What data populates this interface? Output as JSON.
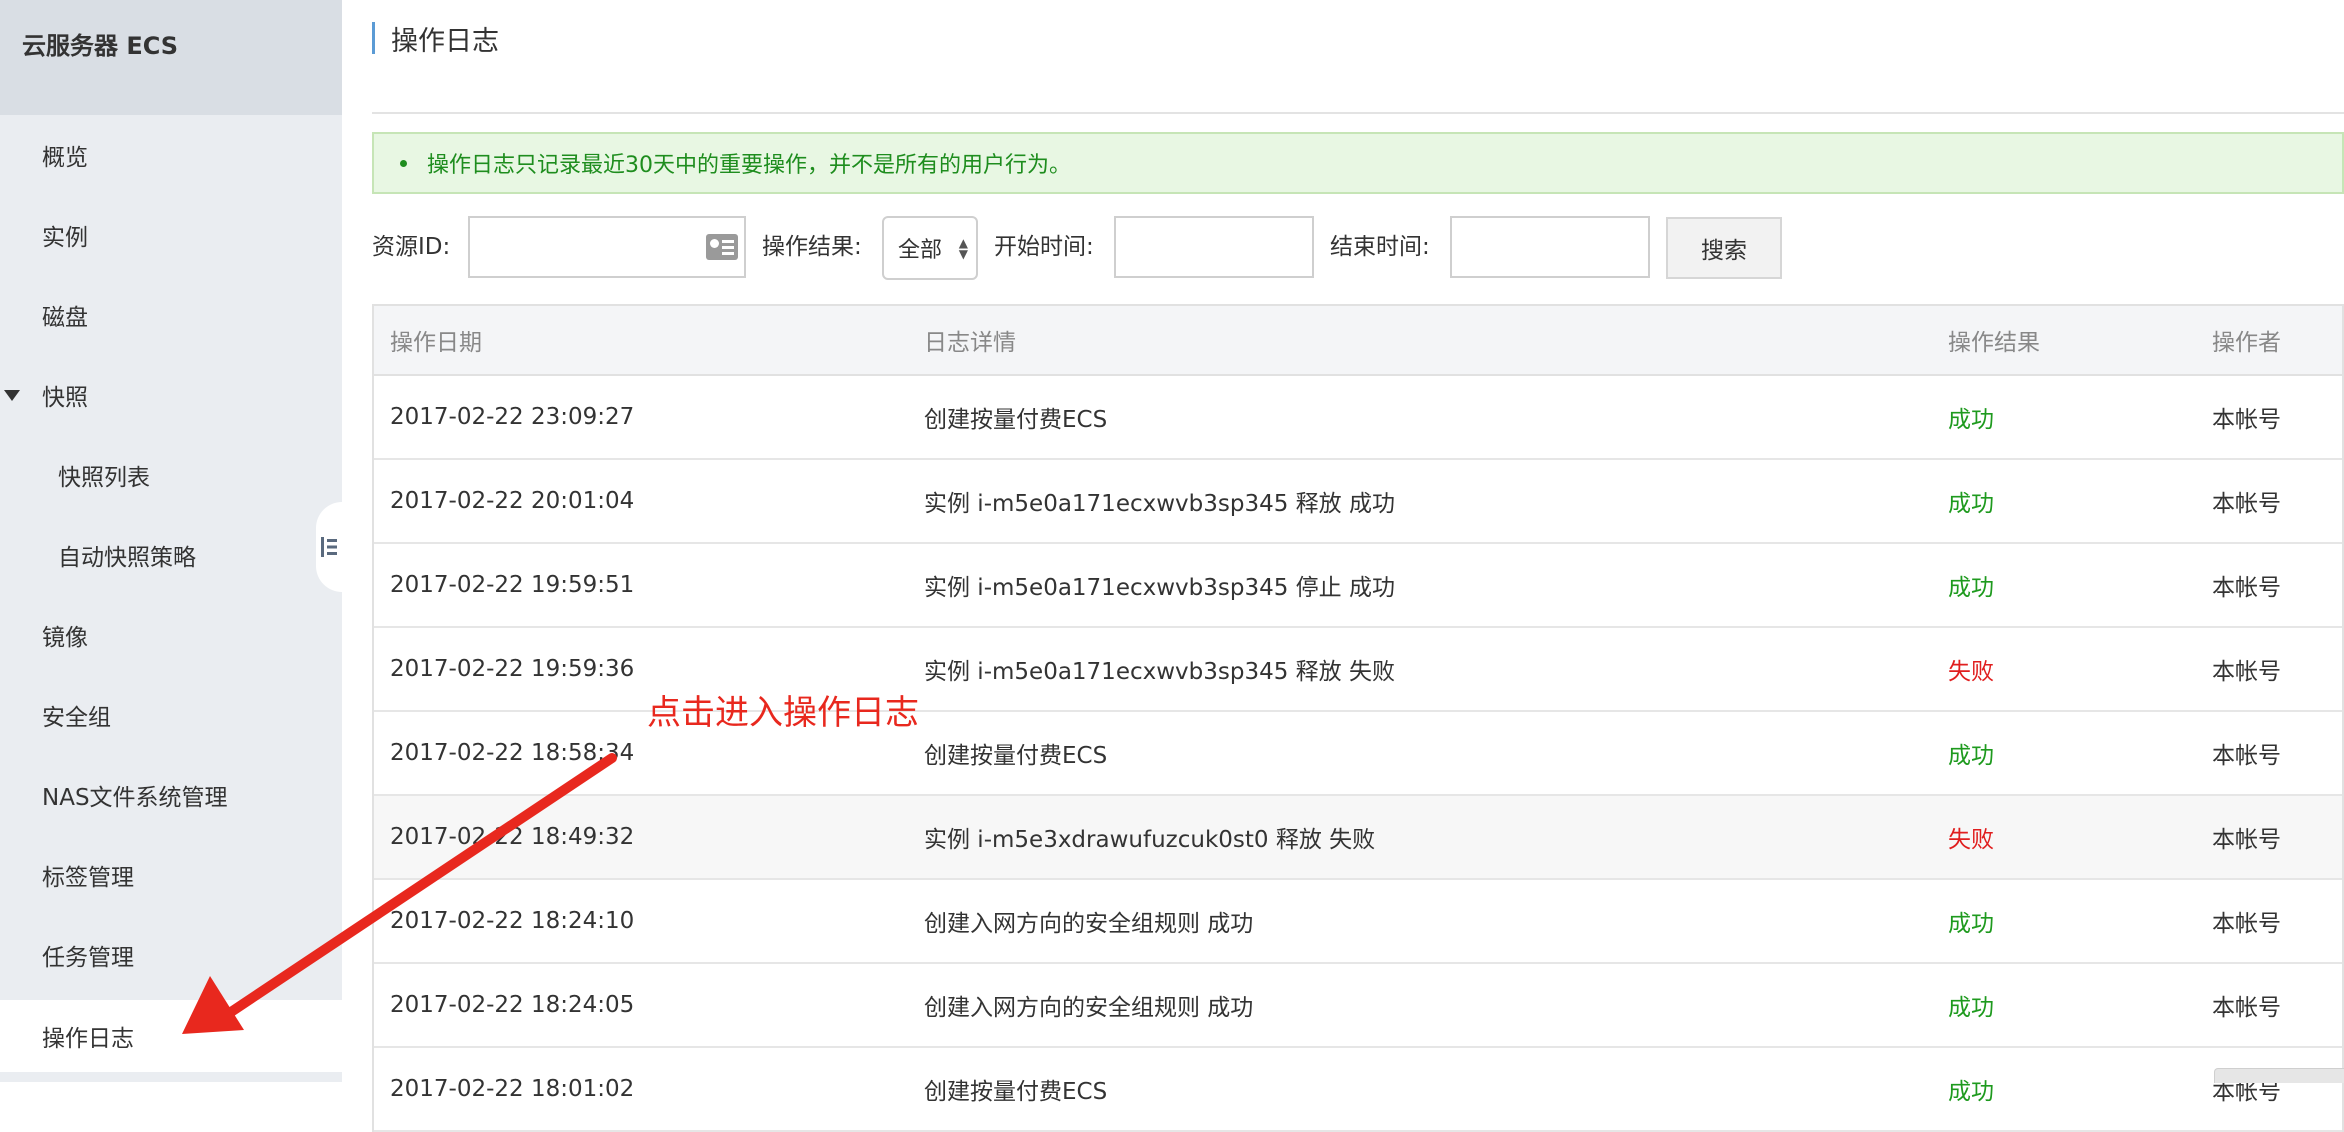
{
  "sidebar": {
    "header": "云服务器 ECS",
    "items": [
      {
        "label": "概览"
      },
      {
        "label": "实例"
      },
      {
        "label": "磁盘"
      },
      {
        "label": "快照"
      },
      {
        "label": "快照列表"
      },
      {
        "label": "自动快照策略"
      },
      {
        "label": "镜像"
      },
      {
        "label": "安全组"
      },
      {
        "label": "NAS文件系统管理"
      },
      {
        "label": "标签管理"
      },
      {
        "label": "任务管理"
      },
      {
        "label": "操作日志"
      }
    ]
  },
  "page": {
    "title": "操作日志",
    "notice": "操作日志只记录最近30天中的重要操作，并不是所有的用户行为。"
  },
  "filters": {
    "resource_id_label": "资源ID:",
    "resource_id_value": "",
    "result_label": "操作结果:",
    "result_value": "全部",
    "start_label": "开始时间:",
    "start_value": "",
    "end_label": "结束时间:",
    "end_value": "",
    "search_label": "搜索"
  },
  "table": {
    "headers": [
      "操作日期",
      "日志详情",
      "操作结果",
      "操作者"
    ],
    "rows": [
      {
        "date": "2017-02-22 23:09:27",
        "detail": "创建按量付费ECS",
        "result": "成功",
        "operator": "本帐号"
      },
      {
        "date": "2017-02-22 20:01:04",
        "detail": "实例 i-m5e0a171ecxwvb3sp345 释放 成功",
        "result": "成功",
        "operator": "本帐号"
      },
      {
        "date": "2017-02-22 19:59:51",
        "detail": "实例 i-m5e0a171ecxwvb3sp345 停止 成功",
        "result": "成功",
        "operator": "本帐号"
      },
      {
        "date": "2017-02-22 19:59:36",
        "detail": "实例 i-m5e0a171ecxwvb3sp345 释放 失败",
        "result": "失败",
        "operator": "本帐号"
      },
      {
        "date": "2017-02-22 18:58:34",
        "detail": "创建按量付费ECS",
        "result": "成功",
        "operator": "本帐号"
      },
      {
        "date": "2017-02-22 18:49:32",
        "detail": "实例 i-m5e3xdrawufuzcuk0st0 释放 失败",
        "result": "失败",
        "operator": "本帐号"
      },
      {
        "date": "2017-02-22 18:24:10",
        "detail": "创建入网方向的安全组规则 成功",
        "result": "成功",
        "operator": "本帐号"
      },
      {
        "date": "2017-02-22 18:24:05",
        "detail": "创建入网方向的安全组规则 成功",
        "result": "成功",
        "operator": "本帐号"
      },
      {
        "date": "2017-02-22 18:01:02",
        "detail": "创建按量付费ECS",
        "result": "成功",
        "operator": "本帐号"
      }
    ]
  },
  "annotation": {
    "text": "点击进入操作日志",
    "color": "#e8281e"
  },
  "colors": {
    "success": "#1e9a1e",
    "failure": "#e01e1e",
    "accent": "#5b9bd5"
  }
}
